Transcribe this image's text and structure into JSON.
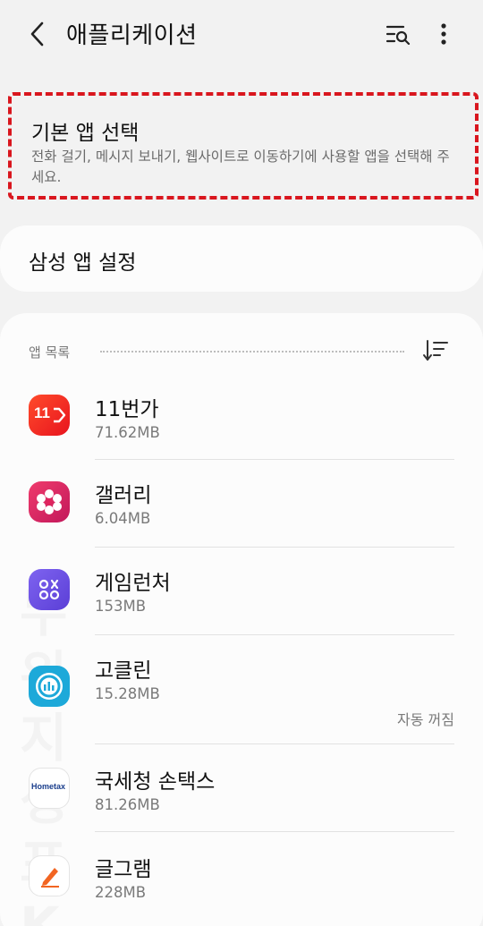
{
  "header": {
    "title": "애플리케이션",
    "back_icon": "chevron-left-icon",
    "search_icon": "search-list-icon",
    "more_icon": "more-vertical-icon"
  },
  "default_apps": {
    "title": "기본 앱 선택",
    "description": "전화 걸기, 메시지 보내기, 웹사이트로 이동하기에 사용할 앱을 선택해 주세요.",
    "highlight_color": "#d9161e"
  },
  "samsung_settings": {
    "label": "삼성 앱 설정"
  },
  "app_list": {
    "header_label": "앱 목록",
    "sort_icon": "sort-icon",
    "apps": [
      {
        "name": "11번가",
        "size": "71.62MB",
        "icon": "11st-icon",
        "icon_text": "11"
      },
      {
        "name": "갤러리",
        "size": "6.04MB",
        "icon": "gallery-icon"
      },
      {
        "name": "게임런처",
        "size": "153MB",
        "icon": "game-launcher-icon"
      },
      {
        "name": "고클린",
        "size": "15.28MB",
        "icon": "goclean-icon",
        "status": "자동 꺼짐"
      },
      {
        "name": "국세청 손택스",
        "size": "81.26MB",
        "icon": "hometax-icon",
        "icon_text": "Hometax"
      },
      {
        "name": "글그램",
        "size": "228MB",
        "icon": "geulgram-icon"
      }
    ]
  }
}
